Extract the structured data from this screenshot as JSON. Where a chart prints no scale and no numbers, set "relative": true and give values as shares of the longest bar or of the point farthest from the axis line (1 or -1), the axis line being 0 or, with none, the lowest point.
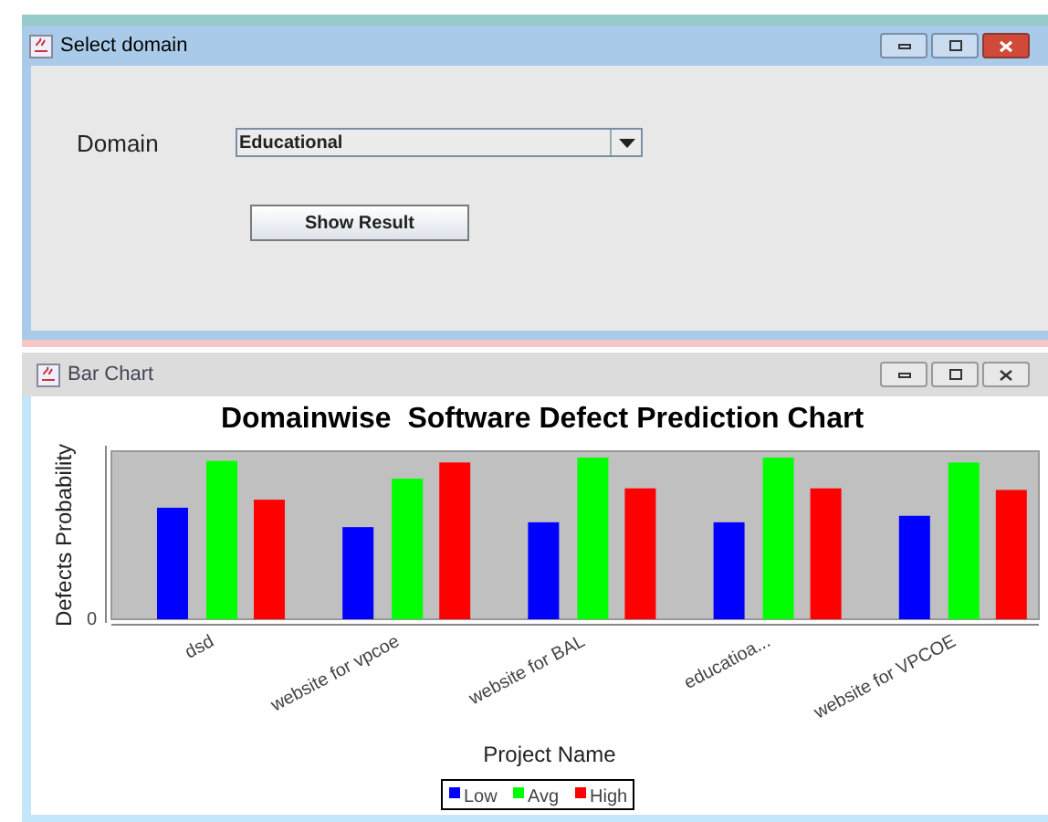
{
  "domain_window": {
    "title": "Select domain",
    "domain_label": "Domain",
    "domain_select": {
      "value": "Educational"
    },
    "button": "Show Result"
  },
  "chart_window": {
    "title": "Bar Chart",
    "chart_data": {
      "type": "bar",
      "title": "Domainwise  Software Defect Prediction Chart",
      "xlabel": "Project Name",
      "ylabel": "Defects Probability",
      "categories": [
        "dsd",
        "website for vpcoe",
        "website for BAL",
        "educatioa...",
        "website for VPCOE"
      ],
      "series": [
        {
          "name": "Low",
          "color": "#0000ff",
          "values": [
            0.69,
            0.57,
            0.6,
            0.6,
            0.64
          ]
        },
        {
          "name": "Avg",
          "color": "#00ff00",
          "values": [
            0.98,
            0.87,
            1,
            1,
            0.97
          ]
        },
        {
          "name": "High",
          "color": "#ff0000",
          "values": [
            0.74,
            0.97,
            0.81,
            0.81,
            0.8
          ]
        }
      ],
      "relative": true,
      "legend": "bottom",
      "annotations": [
        {
          "text": "0"
        }
      ]
    }
  }
}
